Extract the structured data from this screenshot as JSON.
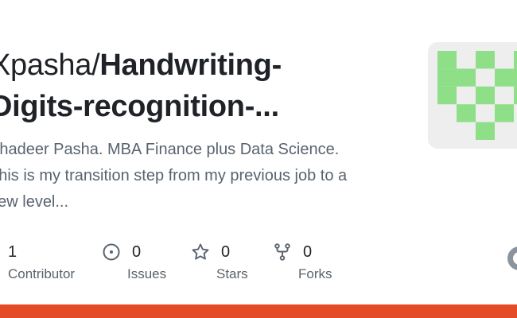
{
  "repo": {
    "owner_prefix": "Xpasha/",
    "name_line1": "Handwriting-",
    "name_line2": "Digits-recognition-..."
  },
  "description": {
    "line1": "Shadeer Pasha. MBA Finance plus Data Science.",
    "line2": "This is my transition step from my previous job to a",
    "line3": "new level..."
  },
  "stats": [
    {
      "value": "1",
      "label": "Contributor",
      "icon": "people-icon"
    },
    {
      "value": "0",
      "label": "Issues",
      "icon": "issue-icon"
    },
    {
      "value": "0",
      "label": "Stars",
      "icon": "star-icon"
    },
    {
      "value": "0",
      "label": "Forks",
      "icon": "fork-icon"
    }
  ],
  "colors": {
    "language_bar": "#e34c26",
    "identicon": "#8fdf89",
    "identicon_bg": "#eeeeee"
  }
}
